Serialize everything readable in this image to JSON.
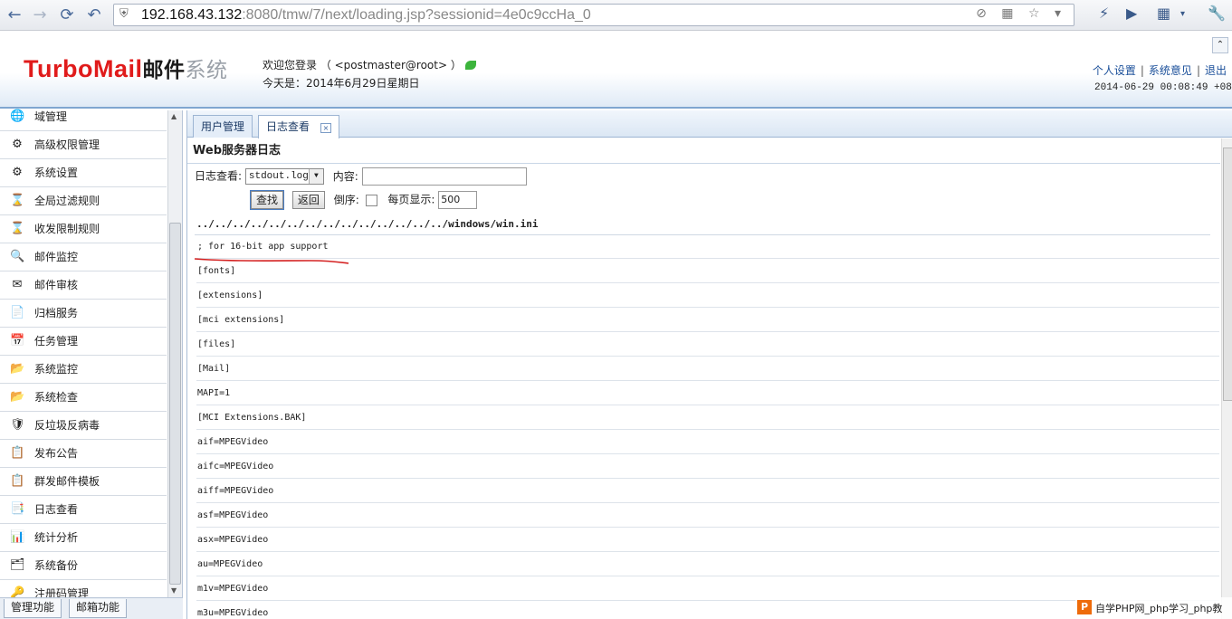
{
  "browser": {
    "back": "←",
    "forward": "→",
    "reload": "⟳",
    "undo": "↶",
    "url_host": "192.168.43.132",
    "url_rest": ":8080/tmw/7/next/loading.jsp?sessionid=4e0c9ccHa_0",
    "right_icons": "⊘ ▦ ☆ ▾"
  },
  "header": {
    "logo_en": "TurboMail",
    "logo_cn1": "邮件",
    "logo_cn2": "系统",
    "welcome": "欢迎您登录 （  <postmaster@root> ）",
    "today": "今天是：2014年6月29日星期日",
    "links": [
      "个人设置",
      "系统意见",
      "退出"
    ],
    "clock": "2014-06-29 00:08:49 +0800"
  },
  "sidebar": {
    "items": [
      {
        "icon": "🌐",
        "label": "域管理"
      },
      {
        "icon": "⚙",
        "label": "高级权限管理"
      },
      {
        "icon": "⚙",
        "label": "系统设置"
      },
      {
        "icon": "⌛",
        "label": "全局过滤规则"
      },
      {
        "icon": "⌛",
        "label": "收发限制规则"
      },
      {
        "icon": "🔍",
        "label": "邮件监控"
      },
      {
        "icon": "✉",
        "label": "邮件审核"
      },
      {
        "icon": "📄",
        "label": "归档服务"
      },
      {
        "icon": "📅",
        "label": "任务管理"
      },
      {
        "icon": "📂",
        "label": "系统监控"
      },
      {
        "icon": "📂",
        "label": "系统检查"
      },
      {
        "icon": "🛡",
        "label": "反垃圾反病毒"
      },
      {
        "icon": "📋",
        "label": "发布公告"
      },
      {
        "icon": "📋",
        "label": "群发邮件模板"
      },
      {
        "icon": "📑",
        "label": "日志查看"
      },
      {
        "icon": "📊",
        "label": "统计分析"
      },
      {
        "icon": "🗂",
        "label": "系统备份"
      },
      {
        "icon": "🔑",
        "label": "注册码管理"
      }
    ],
    "tabs": [
      "管理功能",
      "邮箱功能"
    ]
  },
  "tabs": [
    {
      "label": "用户管理",
      "active": false
    },
    {
      "label": "日志查看",
      "active": true,
      "close": "×"
    }
  ],
  "panel": {
    "title": "Web服务器日志",
    "log_label": "日志查看:",
    "log_select": "stdout.log",
    "content_label": "内容:",
    "content_value": "",
    "search_button": "查找",
    "back_button": "返回",
    "reverse_label": "倒序:",
    "reverse_checked": false,
    "page_size_label": "每页显示:",
    "page_size": "500",
    "path": "../../../../../../../../../../../../../../windows/win.ini",
    "log_lines": [
      "; for 16-bit app support",
      "[fonts]",
      "[extensions]",
      "[mci extensions]",
      "[files]",
      "[Mail]",
      "MAPI=1",
      "[MCI Extensions.BAK]",
      "aif=MPEGVideo",
      "aifc=MPEGVideo",
      "aiff=MPEGVideo",
      "asf=MPEGVideo",
      "asx=MPEGVideo",
      "au=MPEGVideo",
      "m1v=MPEGVideo",
      "m3u=MPEGVideo"
    ]
  },
  "watermark": {
    "badge": "P",
    "text": "自学PHP网_php学习_php教"
  },
  "colors": {
    "logo_red": "#e01b1b",
    "link_blue": "#1a4f9a",
    "annotation_red": "#d42020"
  }
}
